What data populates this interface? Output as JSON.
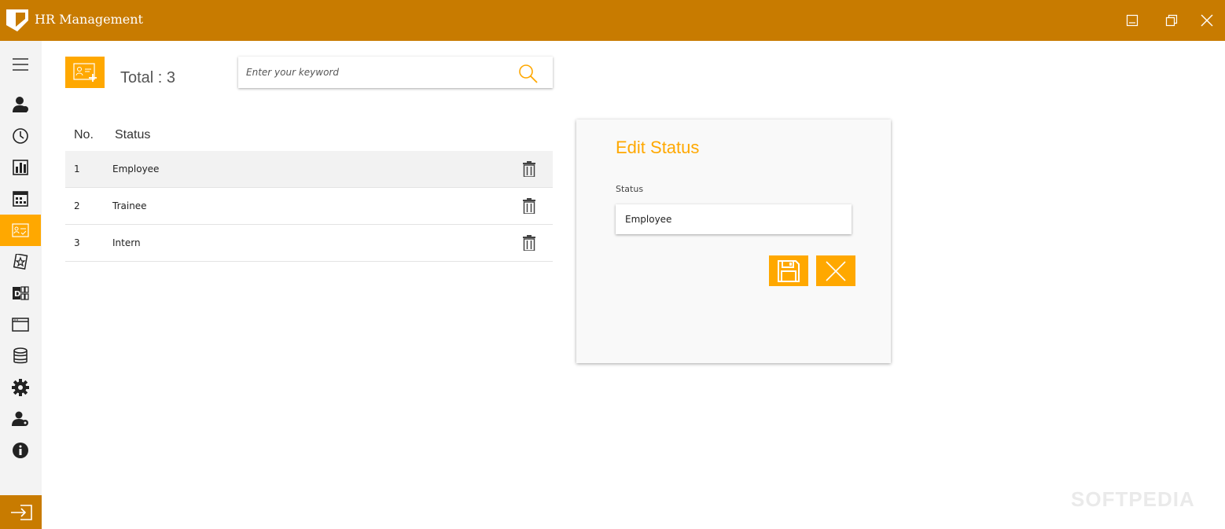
{
  "app": {
    "title": "HR Management"
  },
  "colors": {
    "titlebar": "#c87b00",
    "accent": "#ffa800",
    "sidebar_bg": "#f3f3f3"
  },
  "sidebar": {
    "items": [
      {
        "icon": "menu-icon",
        "active": false
      },
      {
        "icon": "person-icon",
        "active": false
      },
      {
        "icon": "clock-icon",
        "active": false
      },
      {
        "icon": "chart-icon",
        "active": false
      },
      {
        "icon": "calendar-icon",
        "active": false
      },
      {
        "icon": "id-card-icon",
        "active": true
      },
      {
        "icon": "star-cards-icon",
        "active": false
      },
      {
        "icon": "department-icon",
        "active": false
      },
      {
        "icon": "browser-window-icon",
        "active": false
      },
      {
        "icon": "database-icon",
        "active": false
      },
      {
        "icon": "gear-icon",
        "active": false
      },
      {
        "icon": "user-settings-icon",
        "active": false
      },
      {
        "icon": "info-icon",
        "active": false
      }
    ],
    "bottom_icon": "sign-in-icon"
  },
  "toolbar": {
    "total_label": "Total : 3",
    "search_placeholder": "Enter your keyword"
  },
  "table": {
    "headers": {
      "no": "No.",
      "status": "Status"
    },
    "rows": [
      {
        "no": "1",
        "status": "Employee",
        "selected": true
      },
      {
        "no": "2",
        "status": "Trainee",
        "selected": false
      },
      {
        "no": "3",
        "status": "Intern",
        "selected": false
      }
    ]
  },
  "edit_panel": {
    "title": "Edit Status",
    "field_label": "Status",
    "field_value": "Employee"
  },
  "watermark": "SOFTPEDIA"
}
